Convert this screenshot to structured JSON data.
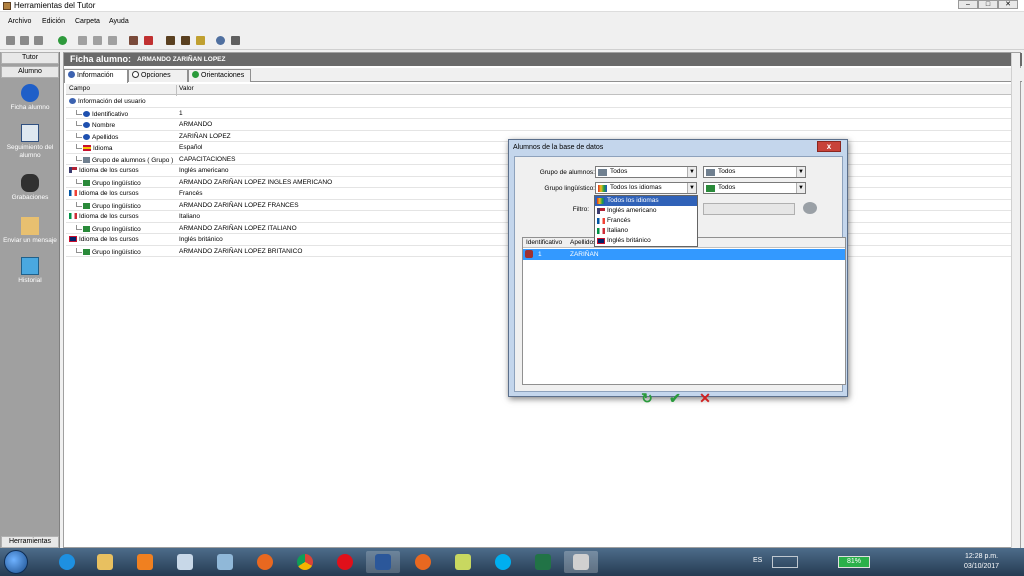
{
  "window": {
    "title": "Herramientas del Tutor",
    "min": "–",
    "max": "□",
    "close": "✕"
  },
  "menu": [
    "Archivo",
    "Edición",
    "Carpeta",
    "Ayuda"
  ],
  "nav": {
    "header_top": "Tutor",
    "header_sub": "Alumno",
    "items": [
      "Ficha alumno",
      "Seguimiento del alumno",
      "Grabaciones",
      "Enviar un mensaje",
      "Historial"
    ],
    "footer": "Herramientas"
  },
  "ficha": {
    "title": "Ficha alumno:",
    "student": "ARMANDO ZARIÑAN LOPEZ",
    "tabs": [
      "Información",
      "Opciones",
      "Orientaciones"
    ],
    "columns": [
      "Campo",
      "Valor"
    ],
    "rows": [
      {
        "campo": "Información del usuario",
        "valor": ""
      },
      {
        "campo": "Identificativo",
        "valor": "1"
      },
      {
        "campo": "Nombre",
        "valor": "ARMANDO"
      },
      {
        "campo": "Apellidos",
        "valor": "ZARIÑAN LOPEZ"
      },
      {
        "campo": "Idioma",
        "valor": "Español"
      },
      {
        "campo": "Grupo de alumnos ( Grupo )",
        "valor": "CAPACITACIONES"
      },
      {
        "campo": "Idioma de los cursos",
        "valor": "Inglés americano"
      },
      {
        "campo": "Grupo lingüístico",
        "valor": "ARMANDO ZARIÑAN LOPEZ INGLES AMERICANO"
      },
      {
        "campo": "Idioma de los cursos",
        "valor": "Francés"
      },
      {
        "campo": "Grupo lingüístico",
        "valor": "ARMANDO ZARIÑAN LOPEZ FRANCES"
      },
      {
        "campo": "Idioma de los cursos",
        "valor": "Italiano"
      },
      {
        "campo": "Grupo lingüístico",
        "valor": "ARMANDO ZARIÑAN LOPEZ ITALIANO"
      },
      {
        "campo": "Idioma de los cursos",
        "valor": "Inglés británico"
      },
      {
        "campo": "Grupo lingüístico",
        "valor": "ARMANDO ZARIÑAN LOPEZ BRITANICO"
      }
    ]
  },
  "dialog": {
    "title": "Alumnos de la base de datos",
    "close": "x",
    "grupo_alumnos_label": "Grupo de alumnos:",
    "grupo_alumnos_value": "Todos",
    "grupo_alumnos_value2": "Todos",
    "grupo_ling_label": "Grupo lingüístico:",
    "grupo_ling_value": "Todos los idiomas",
    "grupo_ling_value2": "Todos",
    "filtro_label": "Filtro:",
    "dropdown_options": [
      "Todos los idiomas",
      "Inglés americano",
      "Francés",
      "Italiano",
      "Inglés británico"
    ],
    "table_columns": [
      "Identificativo",
      "Apellidos"
    ],
    "table_row": {
      "id": "1",
      "apellidos": "ZARIÑAN"
    },
    "buttons": {
      "refresh": "↻",
      "ok": "✔",
      "cancel": "✕"
    }
  },
  "taskbar": {
    "lang": "ES",
    "battery": "81%",
    "time": "12:28 p.m.",
    "date": "03/10/2017"
  }
}
